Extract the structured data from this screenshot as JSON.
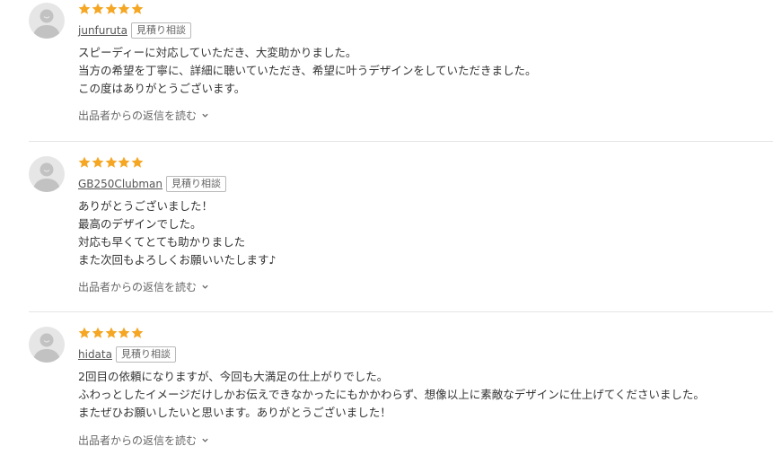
{
  "icons": {
    "star": "star-icon",
    "avatar": "default-user-avatar-icon",
    "chevron": "chevron-down-icon"
  },
  "colors": {
    "star": "#f5a623",
    "avatar_bg": "#e6e6e6",
    "avatar_fg": "#c2c2c2",
    "divider": "#e5e5e5"
  },
  "reviews": [
    {
      "rating": 5,
      "username": "junfuruta",
      "badge": "見積り相談",
      "lines": [
        "スピーディーに対応していただき、大変助かりました。",
        "当方の希望を丁寧に、詳細に聴いていただき、希望に叶うデザインをしていただきました。",
        "この度はありがとうございます。"
      ],
      "reply_label": "出品者からの返信を読む"
    },
    {
      "rating": 5,
      "username": "GB250Clubman",
      "badge": "見積り相談",
      "lines": [
        "ありがとうございました！",
        "最高のデザインでした。",
        "対応も早くてとても助かりました",
        "また次回もよろしくお願いいたします♪"
      ],
      "reply_label": "出品者からの返信を読む"
    },
    {
      "rating": 5,
      "username": "hidata",
      "badge": "見積り相談",
      "lines": [
        "2回目の依頼になりますが、今回も大満足の仕上がりでした。",
        "ふわっとしたイメージだけしかお伝えできなかったにもかかわらず、想像以上に素敵なデザインに仕上げてくださいました。",
        "またぜひお願いしたいと思います。ありがとうございました！"
      ],
      "reply_label": "出品者からの返信を読む"
    }
  ]
}
